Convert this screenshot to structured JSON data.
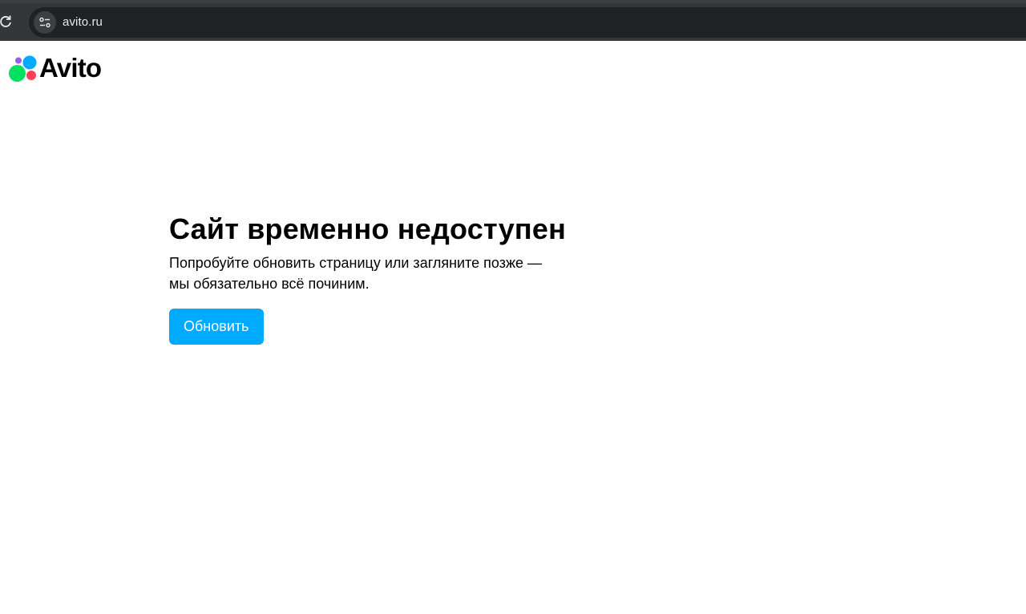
{
  "browser": {
    "url": "avito.ru",
    "reload_icon": "reload-icon",
    "site_info_icon": "tune-icon"
  },
  "logo": {
    "wordmark": "Avito",
    "dot_colors": {
      "purple": "#965eeb",
      "blue": "#0af",
      "green": "#04e061",
      "red": "#ff4053"
    }
  },
  "error": {
    "title": "Сайт временно недоступен",
    "description_line1": "Попробуйте обновить страницу или загляните позже —",
    "description_line2": "мы обязательно всё починим.",
    "refresh_label": "Обновить"
  },
  "colors": {
    "accent": "#00aaff",
    "browser_toolbar": "#35363a",
    "omnibox": "#202124"
  }
}
